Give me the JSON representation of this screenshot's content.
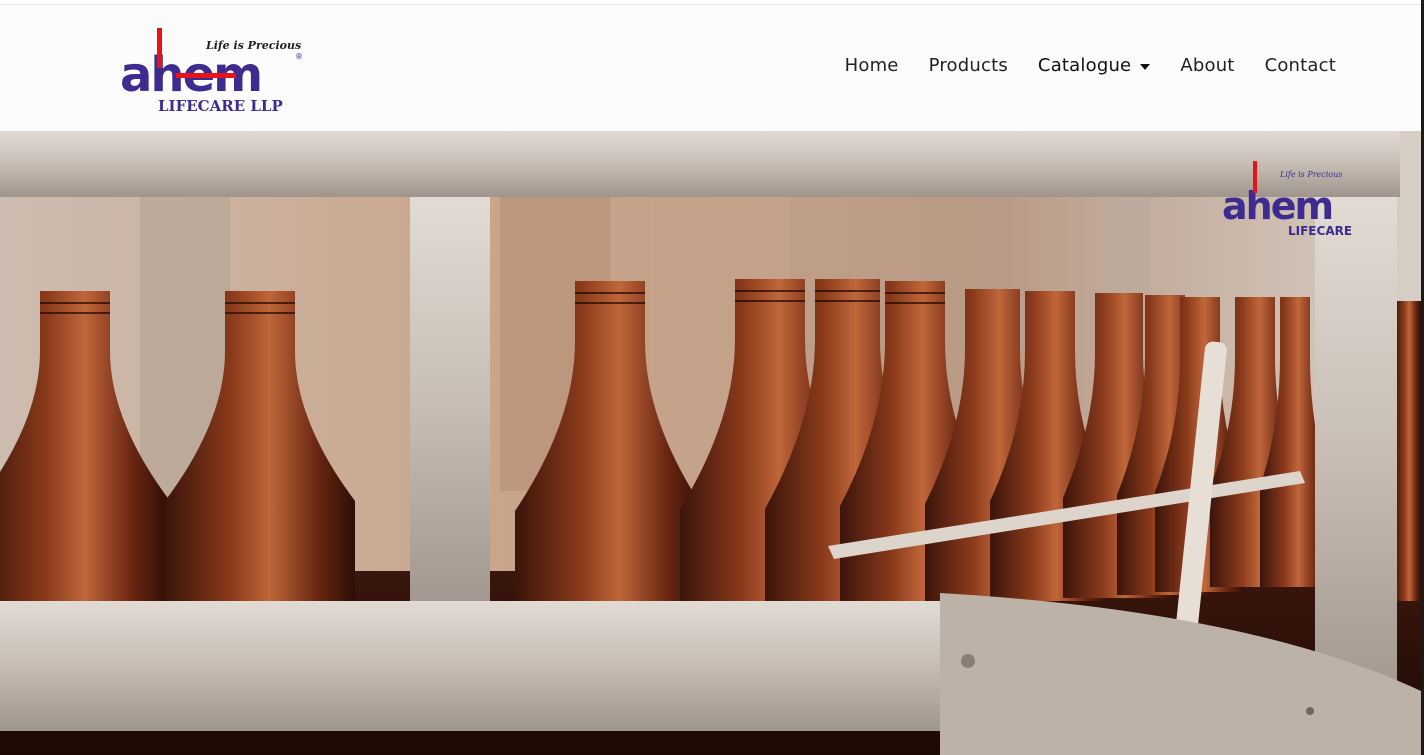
{
  "brand": {
    "logo_tagline": "Life is Precious",
    "logo_word": "ahem",
    "logo_suffix": "LIFECARE LLP",
    "registered_mark": "®",
    "colors": {
      "primary": "#3d2b8f",
      "accent": "#e5141b"
    }
  },
  "nav": {
    "items": [
      {
        "label": "Home"
      },
      {
        "label": "Products"
      },
      {
        "label": "Catalogue"
      },
      {
        "label": "About"
      },
      {
        "label": "Contact"
      }
    ]
  },
  "hero": {
    "watermark_tagline": "Life is Precious",
    "watermark_word": "ahem",
    "watermark_suffix": "LIFECARE"
  }
}
